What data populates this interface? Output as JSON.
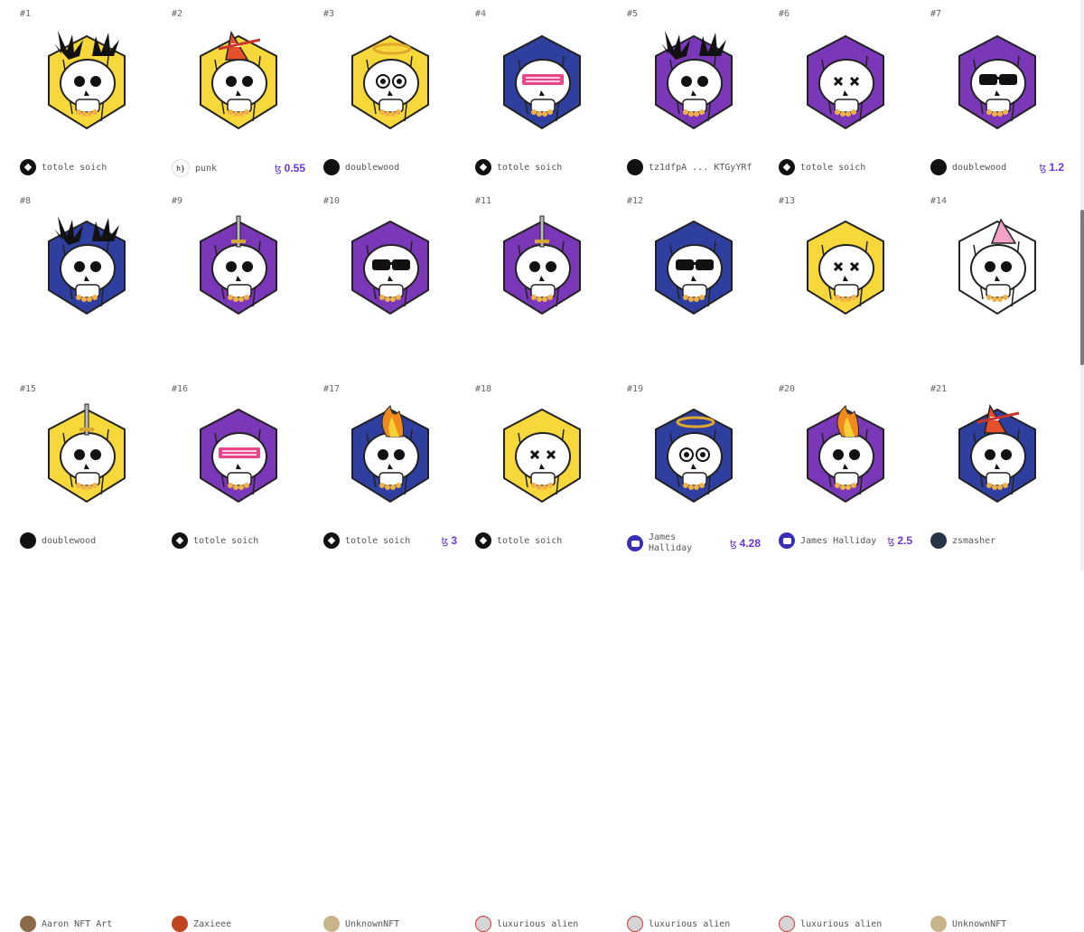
{
  "items": [
    {
      "num": "#1",
      "owner": "totole soich",
      "price": "",
      "avatar": "tezos",
      "hex": "#f7d83b",
      "style": "spike"
    },
    {
      "num": "#2",
      "owner": "punk",
      "price": "0.55",
      "avatar": "punk",
      "hex": "#f7d83b",
      "style": "cone"
    },
    {
      "num": "#3",
      "owner": "doublewood",
      "price": "",
      "avatar": "dark",
      "hex": "#f7d83b",
      "style": "halo"
    },
    {
      "num": "#4",
      "owner": "totole soich",
      "price": "",
      "avatar": "tezos",
      "hex": "#2f3fa0",
      "style": "pinkglasses"
    },
    {
      "num": "#5",
      "owner": "tz1dfpA ... KTGyYRf",
      "price": "",
      "avatar": "dark",
      "hex": "#7a37b8",
      "style": "spike"
    },
    {
      "num": "#6",
      "owner": "totole soich",
      "price": "",
      "avatar": "tezos",
      "hex": "#7a37b8",
      "style": "plain"
    },
    {
      "num": "#7",
      "owner": "doublewood",
      "price": "1.2",
      "avatar": "dark",
      "hex": "#7a37b8",
      "style": "shades"
    },
    {
      "num": "#8",
      "owner": "doublewood",
      "price": "",
      "avatar": "dark",
      "hex": "#2f3fa0",
      "style": "spike"
    },
    {
      "num": "#9",
      "owner": "totole soich",
      "price": "",
      "avatar": "tezos",
      "hex": "#7a37b8",
      "style": "sword"
    },
    {
      "num": "#10",
      "owner": "totole soich",
      "price": "3",
      "avatar": "tezos",
      "hex": "#7a37b8",
      "style": "shades"
    },
    {
      "num": "#11",
      "owner": "totole soich",
      "price": "",
      "avatar": "tezos",
      "hex": "#7a37b8",
      "style": "sword"
    },
    {
      "num": "#12",
      "owner": "James Halliday",
      "price": "4.28",
      "avatar": "robot",
      "hex": "#2f3fa0",
      "style": "shades",
      "wrap": true
    },
    {
      "num": "#13",
      "owner": "James Halliday",
      "price": "2.5",
      "avatar": "robot",
      "hex": "#f7d83b",
      "style": "plain"
    },
    {
      "num": "#14",
      "owner": "zsmasher",
      "price": "",
      "avatar": "game",
      "hex": "#ffffff",
      "style": "party"
    },
    {
      "num": "#15",
      "owner": "Aaron NFT Art",
      "price": "",
      "avatar": "photo",
      "hex": "#f7d83b",
      "style": "sword"
    },
    {
      "num": "#16",
      "owner": "Zaxieee",
      "price": "",
      "avatar": "fire",
      "hex": "#7a37b8",
      "style": "pinkglasses"
    },
    {
      "num": "#17",
      "owner": "UnknownNFT",
      "price": "",
      "avatar": "orb",
      "hex": "#2f3fa0",
      "style": "flame"
    },
    {
      "num": "#18",
      "owner": "luxurious alien",
      "price": "",
      "avatar": "alien",
      "hex": "#f7d83b",
      "style": "plain"
    },
    {
      "num": "#19",
      "owner": "luxurious alien",
      "price": "",
      "avatar": "alien",
      "hex": "#2f3fa0",
      "style": "halo"
    },
    {
      "num": "#20",
      "owner": "luxurious alien",
      "price": "",
      "avatar": "alien",
      "hex": "#7a37b8",
      "style": "flame"
    },
    {
      "num": "#21",
      "owner": "UnknownNFT",
      "price": "",
      "avatar": "orb",
      "hex": "#2f3fa0",
      "style": "cone"
    }
  ],
  "currency_symbol": "ꜩ",
  "colors": {
    "price": "#6a35d8",
    "yellow": "#f7d83b",
    "blue": "#2f3fa0",
    "purple": "#7a37b8"
  }
}
